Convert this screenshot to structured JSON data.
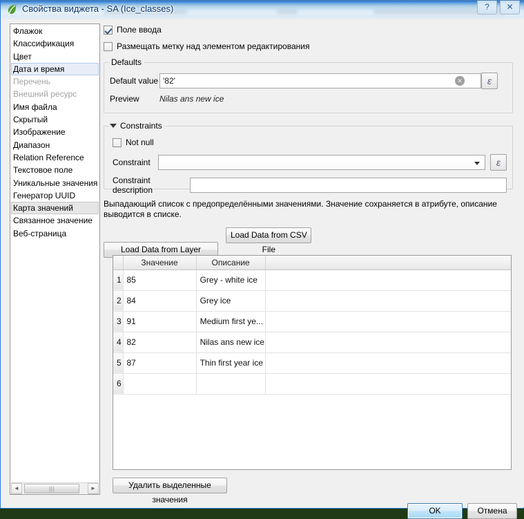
{
  "window": {
    "title": "Свойства виджета - SA (Ice_classes)",
    "app_icon": "qgis-leaf-icon",
    "help_glyph": "?",
    "close_glyph": "✕",
    "accent": "#2b77d4"
  },
  "sidebar": {
    "items": [
      {
        "label": "Флажок",
        "state": "normal"
      },
      {
        "label": "Классификация",
        "state": "normal"
      },
      {
        "label": "Цвет",
        "state": "normal"
      },
      {
        "label": "Дата и время",
        "state": "selected-active"
      },
      {
        "label": "Перечень",
        "state": "disabled"
      },
      {
        "label": "Внешний ресурс",
        "state": "disabled"
      },
      {
        "label": "Имя файла",
        "state": "normal"
      },
      {
        "label": "Скрытый",
        "state": "normal"
      },
      {
        "label": "Изображение",
        "state": "normal"
      },
      {
        "label": "Диапазон",
        "state": "normal"
      },
      {
        "label": "Relation Reference",
        "state": "normal"
      },
      {
        "label": "Текстовое поле",
        "state": "normal"
      },
      {
        "label": "Уникальные значения",
        "state": "normal"
      },
      {
        "label": "Генератор UUID",
        "state": "normal"
      },
      {
        "label": "Карта значений",
        "state": "selected-inactive"
      },
      {
        "label": "Связанное значение",
        "state": "normal"
      },
      {
        "label": "Веб-страница",
        "state": "normal"
      }
    ],
    "scrollbar": {
      "left_arrow": "◄",
      "right_arrow": "►",
      "grip": "|||"
    }
  },
  "options": {
    "editable_label": "Поле ввода",
    "editable_checked": true,
    "label_on_top_label": "Размещать метку над элементом редактирования",
    "label_on_top_checked": false
  },
  "defaults": {
    "group_title": "Defaults",
    "default_value_label": "Default value",
    "default_value": "'82'",
    "default_value_placeholder": "",
    "clear_icon": "✕",
    "expression_icon": "ε",
    "preview_label": "Preview",
    "preview_value": "Nilas ans new ice"
  },
  "constraints": {
    "group_title": "Constraints",
    "collapse_icon": "triangle-down-icon",
    "not_null_label": "Not null",
    "not_null_checked": false,
    "constraint_label": "Constraint",
    "constraint_value": "",
    "constraint_expression_icon": "ε",
    "constraint_desc_label": "Constraint description",
    "constraint_desc_value": ""
  },
  "valuemap": {
    "description": "Выпадающий список с предопределёнными значениями. Значение сохраняется в атрибуте, описание выводится в списке.",
    "load_layer_button": "Load Data from Layer",
    "load_csv_button": "Load Data from CSV File",
    "columns": [
      "Значение",
      "Описание",
      ""
    ],
    "rows": [
      {
        "n": "1",
        "value": "85",
        "description": "Grey - white ice"
      },
      {
        "n": "2",
        "value": "84",
        "description": "Grey ice"
      },
      {
        "n": "3",
        "value": "91",
        "description": "Medium first ye..."
      },
      {
        "n": "4",
        "value": "82",
        "description": "Nilas ans new ice"
      },
      {
        "n": "5",
        "value": "87",
        "description": "Thin first year ice"
      },
      {
        "n": "6",
        "value": "",
        "description": ""
      }
    ],
    "delete_button": "Удалить выделенные значения"
  },
  "footer": {
    "ok_label": "OK",
    "cancel_label": "Отмена"
  }
}
